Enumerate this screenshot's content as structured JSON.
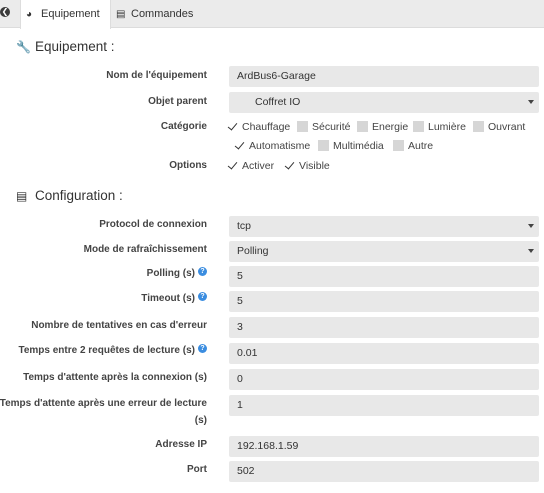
{
  "tabs": [
    {
      "label": "Equipement",
      "icon": "tachometer-icon"
    },
    {
      "label": "Commandes",
      "icon": "list-icon"
    }
  ],
  "section_equipement": {
    "title": "Equipement :",
    "icon": "wrench-icon"
  },
  "section_config": {
    "title": "Configuration :",
    "icon": "list-alt-icon"
  },
  "equipement": {
    "nom_label": "Nom de l'équipement",
    "nom_value": "ArdBus6-Garage",
    "objet_label": "Objet parent",
    "objet_value": "Coffret IO",
    "categorie_label": "Catégorie",
    "categories": [
      {
        "label": "Chauffage",
        "checked": true
      },
      {
        "label": "Sécurité",
        "checked": false
      },
      {
        "label": "Energie",
        "checked": false
      },
      {
        "label": "Lumière",
        "checked": false
      },
      {
        "label": "Ouvrant",
        "checked": false
      },
      {
        "label": "Automatisme",
        "checked": true
      },
      {
        "label": "Multimédia",
        "checked": false
      },
      {
        "label": "Autre",
        "checked": false
      }
    ],
    "options_label": "Options",
    "options": [
      {
        "label": "Activer",
        "checked": true
      },
      {
        "label": "Visible",
        "checked": true
      }
    ]
  },
  "config": {
    "protocol_label": "Protocol de connexion",
    "protocol_value": "tcp",
    "refresh_label": "Mode de rafraîchissement",
    "refresh_value": "Polling",
    "polling_label": "Polling (s)",
    "polling_value": "5",
    "timeout_label": "Timeout (s)",
    "timeout_value": "5",
    "tentatives_label": "Nombre de tentatives en cas d'erreur",
    "tentatives_value": "3",
    "temps_requetes_label": "Temps entre 2 requêtes de lecture (s)",
    "temps_requetes_value": "0.01",
    "attente_connexion_label": "Temps d'attente après la connexion (s)",
    "attente_connexion_value": "0",
    "attente_erreur_label": "Temps d'attente après une erreur de lecture (s)",
    "attente_erreur_value": "1",
    "ip_label": "Adresse IP",
    "ip_value": "192.168.1.59",
    "port_label": "Port",
    "port_value": "502"
  },
  "help_glyph": "?",
  "colors": {
    "help": "#3b8de0",
    "field_bg": "#e8e8e8",
    "tabbar_bg": "#ebebeb"
  }
}
